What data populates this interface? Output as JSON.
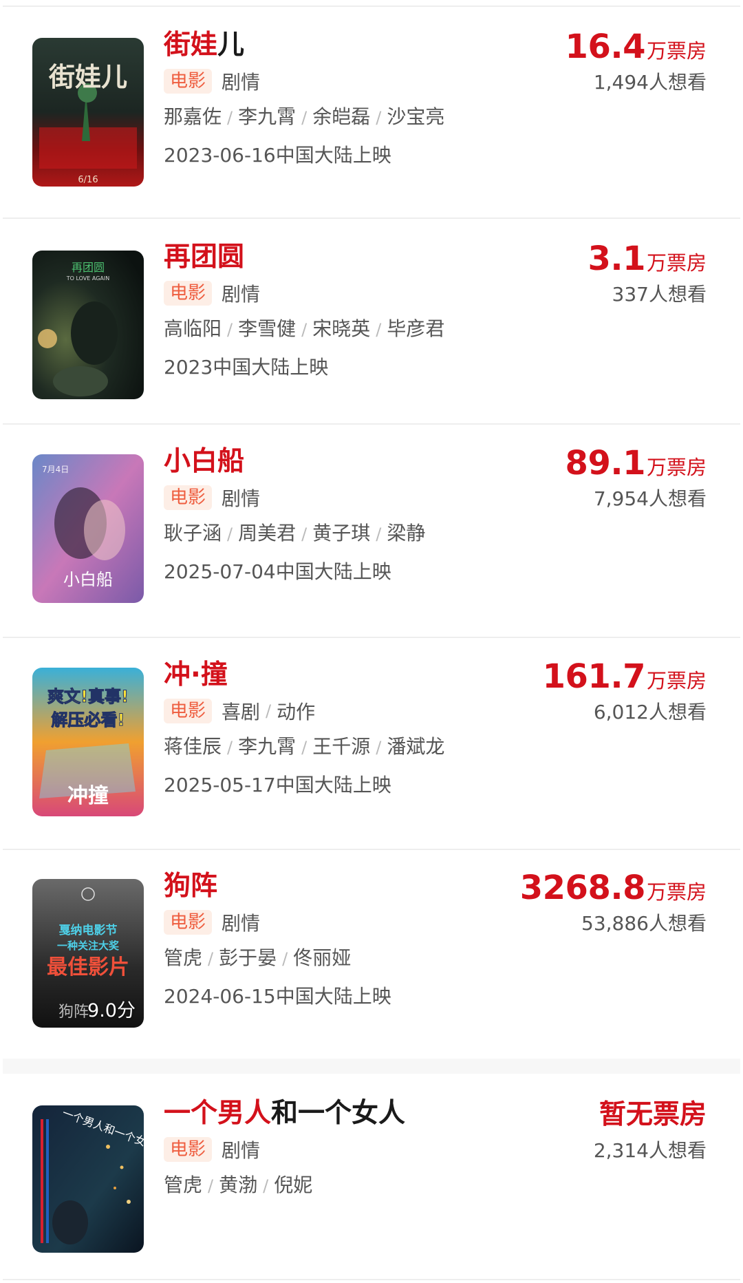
{
  "movies": [
    {
      "title_hl": "街娃",
      "title_rest": "儿",
      "tag": "电影",
      "genres": [
        "剧情"
      ],
      "cast": [
        "那嘉佐",
        "李九霄",
        "余皑磊",
        "沙宝亮"
      ],
      "release": "2023-06-16中国大陆上映",
      "box_value": "16.4",
      "box_unit": "万票房",
      "want": "1,494人想看",
      "poster": {
        "text": "街娃儿",
        "date": "6/16"
      }
    },
    {
      "title_hl": "再团圆",
      "title_rest": "",
      "tag": "电影",
      "genres": [
        "剧情"
      ],
      "cast": [
        "高临阳",
        "李雪健",
        "宋晓英",
        "毕彦君"
      ],
      "release": "2023中国大陆上映",
      "box_value": "3.1",
      "box_unit": "万票房",
      "want": "337人想看",
      "poster": {
        "text": "再团圆",
        "sub": "TO LOVE AGAIN"
      }
    },
    {
      "title_hl": "小白船",
      "title_rest": "",
      "tag": "电影",
      "genres": [
        "剧情"
      ],
      "cast": [
        "耿子涵",
        "周美君",
        "黄子琪",
        "梁静"
      ],
      "release": "2025-07-04中国大陆上映",
      "box_value": "89.1",
      "box_unit": "万票房",
      "want": "7,954人想看",
      "poster": {
        "text": "小白船",
        "date": "7月4日"
      }
    },
    {
      "title_hl": "冲",
      "title_mid": "·",
      "title_hl2": "撞",
      "title_rest": "",
      "tag": "电影",
      "genres": [
        "喜剧",
        "动作"
      ],
      "cast": [
        "蒋佳辰",
        "李九霄",
        "王千源",
        "潘斌龙"
      ],
      "release": "2025-05-17中国大陆上映",
      "box_value": "161.7",
      "box_unit": "万票房",
      "want": "6,012人想看",
      "poster": {
        "line1": "爽文!真事!",
        "line2": "解压必看!",
        "text": "冲撞"
      }
    },
    {
      "title_hl": "狗阵",
      "title_rest": "",
      "tag": "电影",
      "genres": [
        "剧情"
      ],
      "cast": [
        "管虎",
        "彭于晏",
        "佟丽娅"
      ],
      "release": "2024-06-15中国大陆上映",
      "box_value": "3268.8",
      "box_unit": "万票房",
      "want": "53,886人想看",
      "rating": "9.0分",
      "poster": {
        "line1": "戛纳电影节",
        "line2": "一种关注大奖",
        "line3": "最佳影片",
        "text": "狗阵"
      }
    },
    {
      "title_hl": "一个男人",
      "title_rest": "和一个女人",
      "tag": "电影",
      "genres": [
        "剧情"
      ],
      "cast": [
        "管虎",
        "黄渤",
        "倪妮"
      ],
      "release": "",
      "box_none": "暂无票房",
      "want": "2,314人想看",
      "poster": {
        "text": "一个男人和一个女人"
      }
    }
  ],
  "colors": {
    "accent_red": "#d3111b",
    "tag_bg": "#fdeee6",
    "tag_fg": "#ee5d3f",
    "text_gray": "#555555",
    "separator": "#eeeeee"
  },
  "icons": [
    "poster-image"
  ]
}
